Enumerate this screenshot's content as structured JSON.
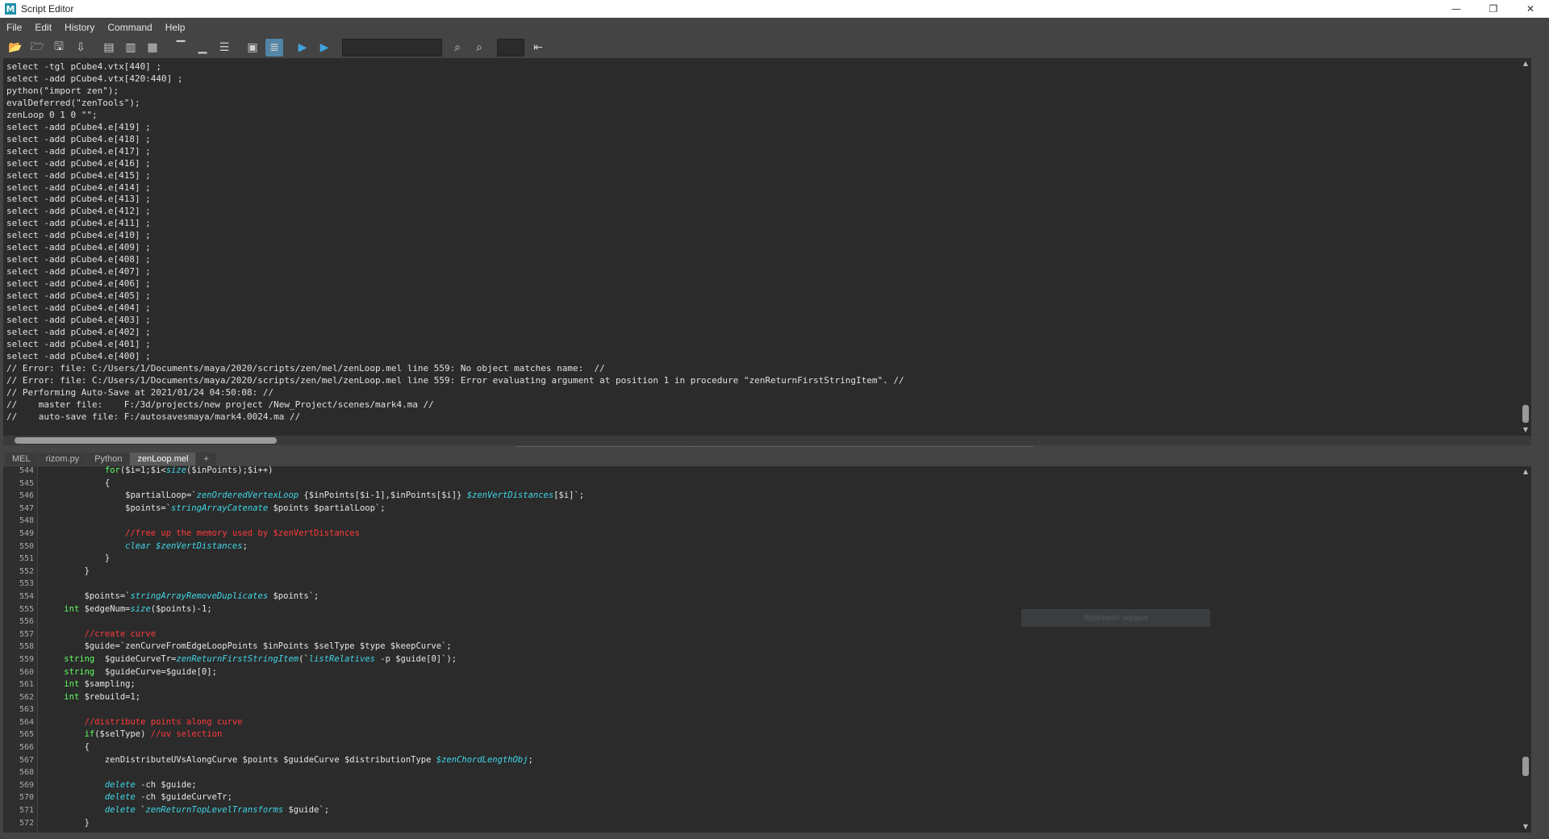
{
  "window": {
    "title": "Script Editor",
    "icon": "M"
  },
  "window_controls": [
    "—",
    "❐",
    "✕"
  ],
  "menu": [
    "File",
    "Edit",
    "History",
    "Command",
    "Help"
  ],
  "toolbar": {
    "icons": [
      "open-script-icon",
      "source-script-icon",
      "save-script-icon",
      "save-to-shelf-icon",
      "clear-history-icon",
      "clear-input-icon",
      "clear-all-icon",
      "show-history-icon",
      "show-input-icon",
      "show-both-icon",
      "echo-all-commands-icon",
      "line-numbers-icon",
      "execute-all-icon",
      "execute-icon",
      "search-next-icon",
      "search-prev-icon",
      "indent-icon"
    ],
    "search_value": "",
    "small_field_value": ""
  },
  "history": {
    "lines": [
      "select -tgl pCube4.vtx[440] ;",
      "select -add pCube4.vtx[420:440] ;",
      "python(\"import zen\");",
      "evalDeferred(\"zenTools\");",
      "zenLoop 0 1 0 \"\";",
      "select -add pCube4.e[419] ;",
      "select -add pCube4.e[418] ;",
      "select -add pCube4.e[417] ;",
      "select -add pCube4.e[416] ;",
      "select -add pCube4.e[415] ;",
      "select -add pCube4.e[414] ;",
      "select -add pCube4.e[413] ;",
      "select -add pCube4.e[412] ;",
      "select -add pCube4.e[411] ;",
      "select -add pCube4.e[410] ;",
      "select -add pCube4.e[409] ;",
      "select -add pCube4.e[408] ;",
      "select -add pCube4.e[407] ;",
      "select -add pCube4.e[406] ;",
      "select -add pCube4.e[405] ;",
      "select -add pCube4.e[404] ;",
      "select -add pCube4.e[403] ;",
      "select -add pCube4.e[402] ;",
      "select -add pCube4.e[401] ;",
      "select -add pCube4.e[400] ;",
      "// Error: file: C:/Users/1/Documents/maya/2020/scripts/zen/mel/zenLoop.mel line 559: No object matches name:  //",
      "// Error: file: C:/Users/1/Documents/maya/2020/scripts/zen/mel/zenLoop.mel line 559: Error evaluating argument at position 1 in procedure \"zenReturnFirstStringItem\". //",
      "// Performing Auto-Save at 2021/01/24 04:50:08: //",
      "//    master file:    F:/3d/projects/new project /New_Project/scenes/mark4.ma //",
      "//    auto-save file: F:/autosavesmaya/mark4.0024.ma //"
    ]
  },
  "tabs": [
    "MEL",
    "rizom.py",
    "Python",
    "zenLoop.mel",
    "+"
  ],
  "active_tab": "zenLoop.mel",
  "editor": {
    "line_numbers": [
      "544",
      "545",
      "546",
      "547",
      "548",
      "549",
      "550",
      "551",
      "552",
      "553",
      "554",
      "555",
      "556",
      "557",
      "558",
      "559",
      "560",
      "561",
      "562",
      "563",
      "564",
      "565",
      "566",
      "567",
      "568",
      "569",
      "570",
      "571",
      "572"
    ],
    "lines": [
      [
        {
          "t": "            "
        },
        {
          "t": "for",
          "c": "kw"
        },
        {
          "t": "($i=1;$i<"
        },
        {
          "t": "size",
          "c": "fn"
        },
        {
          "t": "($inPoints);$i++)"
        }
      ],
      [
        {
          "t": "            {"
        }
      ],
      [
        {
          "t": "                $partialLoop=`"
        },
        {
          "t": "zenOrderedVertexLoop",
          "c": "fn"
        },
        {
          "t": " {$inPoints[$i-1],$inPoints[$i]} "
        },
        {
          "t": "$zenVertDistances",
          "c": "fn"
        },
        {
          "t": "[$i]`;"
        }
      ],
      [
        {
          "t": "                $points=`"
        },
        {
          "t": "stringArrayCatenate",
          "c": "fn"
        },
        {
          "t": " $points $partialLoop`;"
        }
      ],
      [
        {
          "t": ""
        }
      ],
      [
        {
          "t": "                "
        },
        {
          "t": "//free up the memory used by $zenVertDistances",
          "c": "cm"
        }
      ],
      [
        {
          "t": "                "
        },
        {
          "t": "clear",
          "c": "fn"
        },
        {
          "t": " "
        },
        {
          "t": "$zenVertDistances",
          "c": "fn"
        },
        {
          "t": ";"
        }
      ],
      [
        {
          "t": "            }"
        }
      ],
      [
        {
          "t": "        }"
        }
      ],
      [
        {
          "t": ""
        }
      ],
      [
        {
          "t": "        $points=`"
        },
        {
          "t": "stringArrayRemoveDuplicates",
          "c": "fn"
        },
        {
          "t": " $points`;"
        }
      ],
      [
        {
          "t": "    "
        },
        {
          "t": "int",
          "c": "kw"
        },
        {
          "t": " $edgeNum="
        },
        {
          "t": "size",
          "c": "fn"
        },
        {
          "t": "($points)-1;"
        }
      ],
      [
        {
          "t": ""
        }
      ],
      [
        {
          "t": "        "
        },
        {
          "t": "//create curve",
          "c": "cm"
        }
      ],
      [
        {
          "t": "        $guide=`zenCurveFromEdgeLoopPoints $inPoints $selType $type $keepCurve`;"
        }
      ],
      [
        {
          "t": "    "
        },
        {
          "t": "string",
          "c": "kw"
        },
        {
          "t": "  $guideCurveTr="
        },
        {
          "t": "zenReturnFirstStringItem",
          "c": "fn"
        },
        {
          "t": "(`"
        },
        {
          "t": "listRelatives",
          "c": "fn"
        },
        {
          "t": " -p $guide[0]`);"
        }
      ],
      [
        {
          "t": "    "
        },
        {
          "t": "string",
          "c": "kw"
        },
        {
          "t": "  $guideCurve=$guide[0];"
        }
      ],
      [
        {
          "t": "    "
        },
        {
          "t": "int",
          "c": "kw"
        },
        {
          "t": " $sampling;"
        }
      ],
      [
        {
          "t": "    "
        },
        {
          "t": "int",
          "c": "kw"
        },
        {
          "t": " $rebuild=1;"
        }
      ],
      [
        {
          "t": ""
        }
      ],
      [
        {
          "t": "        "
        },
        {
          "t": "//distribute points along curve",
          "c": "cm"
        }
      ],
      [
        {
          "t": "        "
        },
        {
          "t": "if",
          "c": "kw"
        },
        {
          "t": "($selType) "
        },
        {
          "t": "//uv selection",
          "c": "cm"
        }
      ],
      [
        {
          "t": "        {"
        }
      ],
      [
        {
          "t": "            zenDistributeUVsAlongCurve $points $guideCurve $distributionType "
        },
        {
          "t": "$zenChordLengthObj",
          "c": "fn"
        },
        {
          "t": ";"
        }
      ],
      [
        {
          "t": ""
        }
      ],
      [
        {
          "t": "            "
        },
        {
          "t": "delete",
          "c": "fn"
        },
        {
          "t": " -ch $guide;"
        }
      ],
      [
        {
          "t": "            "
        },
        {
          "t": "delete",
          "c": "fn"
        },
        {
          "t": " -ch $guideCurveTr;"
        }
      ],
      [
        {
          "t": "            "
        },
        {
          "t": "delete",
          "c": "fn"
        },
        {
          "t": " `"
        },
        {
          "t": "zenReturnTopLevelTransforms",
          "c": "fn"
        },
        {
          "t": " $guide`;"
        }
      ],
      [
        {
          "t": "        }"
        }
      ]
    ]
  },
  "tooltip_ghost": "Фрагмент экрана",
  "colors": {
    "panel": "#2b2b2b",
    "chrome": "#444444",
    "keyword": "#5fff5f",
    "function": "#3fd6e6",
    "comment": "#ff3a3a",
    "accent": "#5285a6"
  }
}
